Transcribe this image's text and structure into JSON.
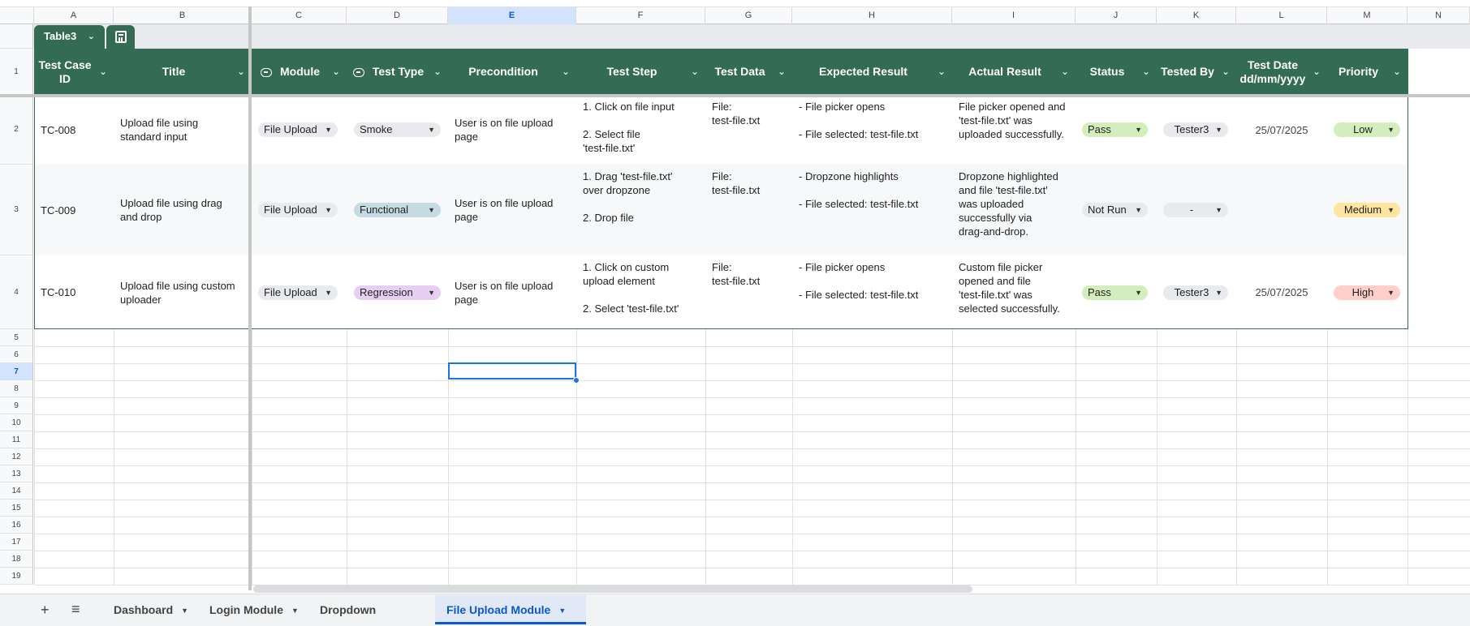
{
  "column_letters": [
    "A",
    "B",
    "C",
    "D",
    "E",
    "F",
    "G",
    "H",
    "I",
    "J",
    "K",
    "L",
    "M",
    "N"
  ],
  "active_column": "E",
  "row_numbers": [
    "1",
    "2",
    "3",
    "4",
    "5",
    "6",
    "7",
    "8",
    "9",
    "10",
    "11",
    "12",
    "13",
    "14",
    "15",
    "16",
    "17",
    "18",
    "19"
  ],
  "active_row": "7",
  "table": {
    "name": "Table3",
    "headers": [
      "Test Case ID",
      "Title",
      "Module",
      "Test Type",
      "Precondition",
      "Test Step",
      "Test Data",
      "Expected Result",
      "Actual Result",
      "Status",
      "Tested By",
      "Test Date\ndd/mm/yyyy",
      "Priority"
    ],
    "rows": [
      {
        "id": "TC-008",
        "title": "Upload file using\nstandard input",
        "module": "File Upload",
        "test_type": "Smoke",
        "precondition": "User is on file upload\npage",
        "test_step": "1. Click on file input\n\n2. Select file\n'test-file.txt'",
        "test_data": "File:\ntest-file.txt",
        "expected": "- File picker opens\n\n- File selected: test-file.txt",
        "actual": "File picker opened and\n'test-file.txt' was\nuploaded successfully.",
        "status": "Pass",
        "tested_by": "Tester3",
        "test_date": "25/07/2025",
        "priority": "Low"
      },
      {
        "id": "TC-009",
        "title": "Upload file using drag\nand drop",
        "module": "File Upload",
        "test_type": "Functional",
        "precondition": "User is on file upload\npage",
        "test_step": "1. Drag 'test-file.txt'\nover dropzone\n\n2. Drop file",
        "test_data": "File:\ntest-file.txt",
        "expected": "- Dropzone highlights\n\n- File selected: test-file.txt",
        "actual": "Dropzone highlighted\nand file 'test-file.txt'\nwas uploaded\nsuccessfully via\ndrag-and-drop.",
        "status": "Not Run",
        "tested_by": "-",
        "test_date": "",
        "priority": "Medium"
      },
      {
        "id": "TC-010",
        "title": "Upload file using custom\nuploader",
        "module": "File Upload",
        "test_type": "Regression",
        "precondition": "User is on file upload\npage",
        "test_step": "1. Click on custom\nupload element\n\n2. Select 'test-file.txt'",
        "test_data": "File:\ntest-file.txt",
        "expected": "- File picker opens\n\n- File selected: test-file.txt",
        "actual": "Custom file picker\nopened and file\n'test-file.txt' was\nselected successfully.",
        "status": "Pass",
        "tested_by": "Tester3",
        "test_date": "25/07/2025",
        "priority": "High"
      }
    ]
  },
  "chip_colors": {
    "module": "#e8eaed",
    "Smoke": "#e8eaed",
    "Functional": "#c6dbe1",
    "Regression": "#e6cff2",
    "Pass": "#d4edbc",
    "Not Run": "#e8eaed",
    "tester": "#e8eaed",
    "Low": "#d4edbc",
    "Medium": "#ffe5a0",
    "High": "#ffcfc9"
  },
  "sheets": {
    "add_icon": "plus-icon",
    "menu_icon": "hamburger-icon",
    "tabs": [
      "Dashboard",
      "Login Module",
      "Dropdown Module",
      "File Upload Module"
    ],
    "active": "File Upload Module"
  }
}
